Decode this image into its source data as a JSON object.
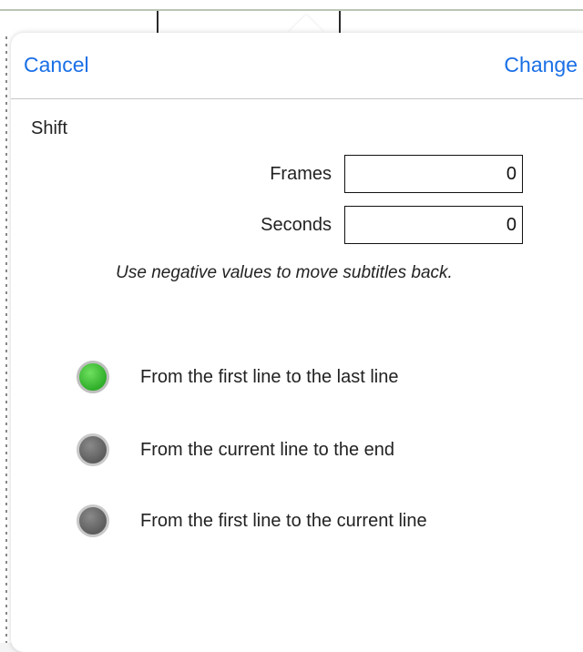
{
  "nav": {
    "cancel_label": "Cancel",
    "change_label": "Change"
  },
  "shift": {
    "section_label": "Shift",
    "frames": {
      "label": "Frames",
      "value": "0"
    },
    "seconds": {
      "label": "Seconds",
      "value": "0"
    },
    "hint": "Use negative values to move subtitles back."
  },
  "options": [
    {
      "label": "From the first line to the last line",
      "selected": true
    },
    {
      "label": "From the current line to the end",
      "selected": false
    },
    {
      "label": "From the first line to the current line",
      "selected": false
    }
  ],
  "colors": {
    "accent": "#1a6fe6",
    "selected_radio": "#2fae2a",
    "unselected_radio": "#5c5c5c"
  }
}
